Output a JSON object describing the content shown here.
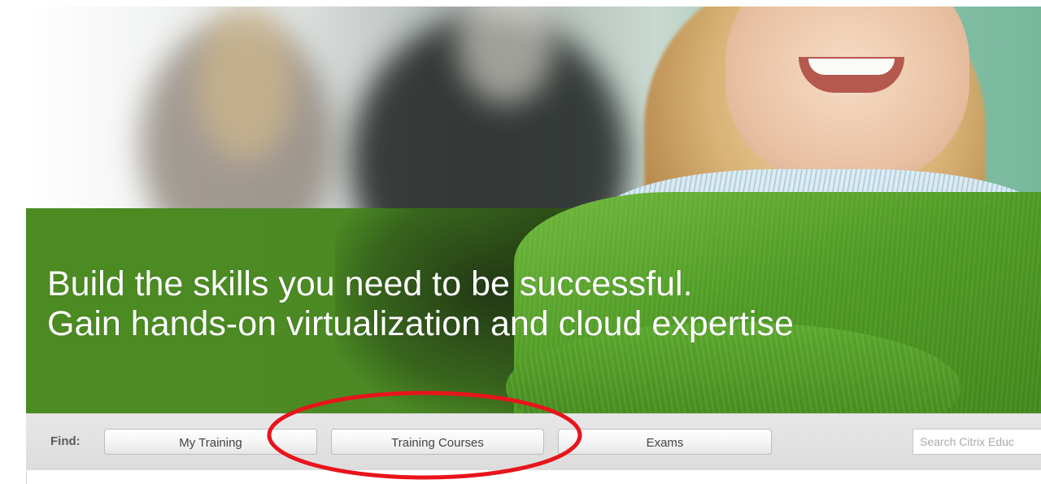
{
  "hero": {
    "tagline_line1": "Build the skills you need to be successful.",
    "tagline_line2": "Gain hands-on virtualization and cloud expertise",
    "band_color": "#4c8b22"
  },
  "findbar": {
    "label": "Find:",
    "buttons": [
      {
        "label": "My Training"
      },
      {
        "label": "Training Courses"
      },
      {
        "label": "Exams"
      }
    ],
    "search_placeholder": "Search Citrix Educ"
  },
  "annotation": {
    "shape": "ellipse",
    "color": "#e8141b",
    "highlighted_item": "Training Courses"
  }
}
